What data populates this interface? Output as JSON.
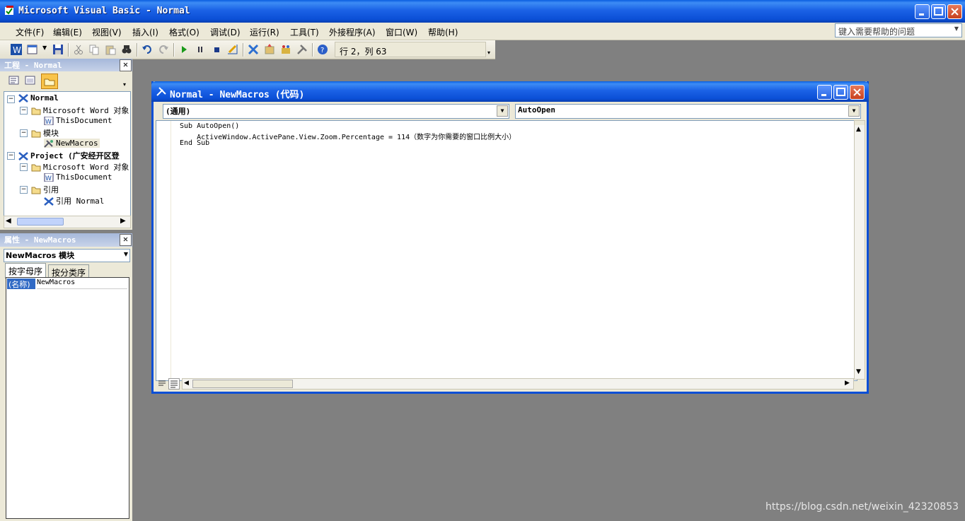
{
  "window": {
    "title": "Microsoft Visual Basic - Normal"
  },
  "menu": {
    "items": [
      "文件(F)",
      "编辑(E)",
      "视图(V)",
      "插入(I)",
      "格式(O)",
      "调试(D)",
      "运行(R)",
      "工具(T)",
      "外接程序(A)",
      "窗口(W)",
      "帮助(H)"
    ]
  },
  "help_search": {
    "value": "键入需要帮助的问题"
  },
  "toolbar": {
    "position_status": "行 2，列 63"
  },
  "project_panel": {
    "title": "工程 - Normal",
    "tree": [
      {
        "label": "Normal",
        "level": 0,
        "bold": true,
        "icon": "vba-project-icon"
      },
      {
        "label": "Microsoft Word 对象",
        "level": 1,
        "icon": "folder-icon"
      },
      {
        "label": "ThisDocument",
        "level": 2,
        "icon": "word-doc-icon"
      },
      {
        "label": "模块",
        "level": 1,
        "icon": "folder-icon"
      },
      {
        "label": "NewMacros",
        "level": 2,
        "icon": "module-icon"
      },
      {
        "label": "Project (广安经开区登",
        "level": 0,
        "bold": true,
        "icon": "vba-project-icon"
      },
      {
        "label": "Microsoft Word 对象",
        "level": 1,
        "icon": "folder-icon"
      },
      {
        "label": "ThisDocument",
        "level": 2,
        "icon": "word-doc-icon"
      },
      {
        "label": "引用",
        "level": 1,
        "icon": "folder-icon"
      },
      {
        "label": "引用 Normal",
        "level": 2,
        "icon": "vba-project-icon"
      }
    ]
  },
  "properties_panel": {
    "title": "属性 - NewMacros",
    "object_select": "NewMacros 模块",
    "tabs": [
      "按字母序",
      "按分类序"
    ],
    "rows": [
      {
        "name": "(名称)",
        "value": "NewMacros"
      }
    ]
  },
  "code_window": {
    "title": "Normal - NewMacros (代码)",
    "object_combo": "(通用)",
    "procedure_combo": "AutoOpen",
    "lines": [
      "Sub AutoOpen()",
      "    ActiveWindow.ActivePane.View.Zoom.Percentage = 114（数字为你需要的窗口比例大小）",
      "End Sub"
    ]
  },
  "watermark": "https://blog.csdn.net/weixin_42320853"
}
